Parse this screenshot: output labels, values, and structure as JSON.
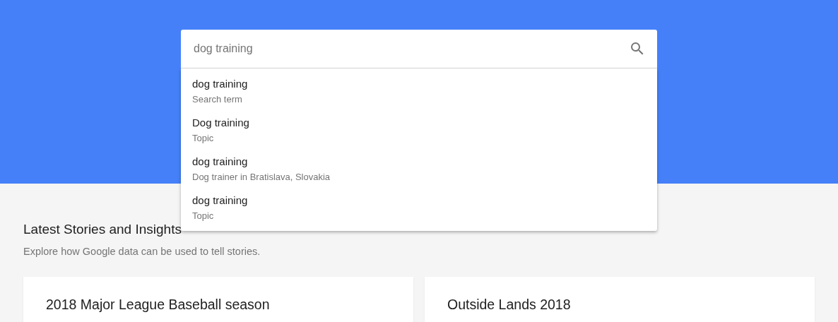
{
  "search": {
    "value": "dog training"
  },
  "suggestions": [
    {
      "title": "dog training",
      "type": "Search term"
    },
    {
      "title": "Dog training",
      "type": "Topic"
    },
    {
      "title": "dog training",
      "type": "Dog trainer in Bratislava, Slovakia"
    },
    {
      "title": "dog training",
      "type": "Topic"
    }
  ],
  "section": {
    "title": "Latest Stories and Insights",
    "subtitle": "Explore how Google data can be used to tell stories."
  },
  "cards": [
    {
      "title": "2018 Major League Baseball season"
    },
    {
      "title": "Outside Lands 2018"
    }
  ]
}
